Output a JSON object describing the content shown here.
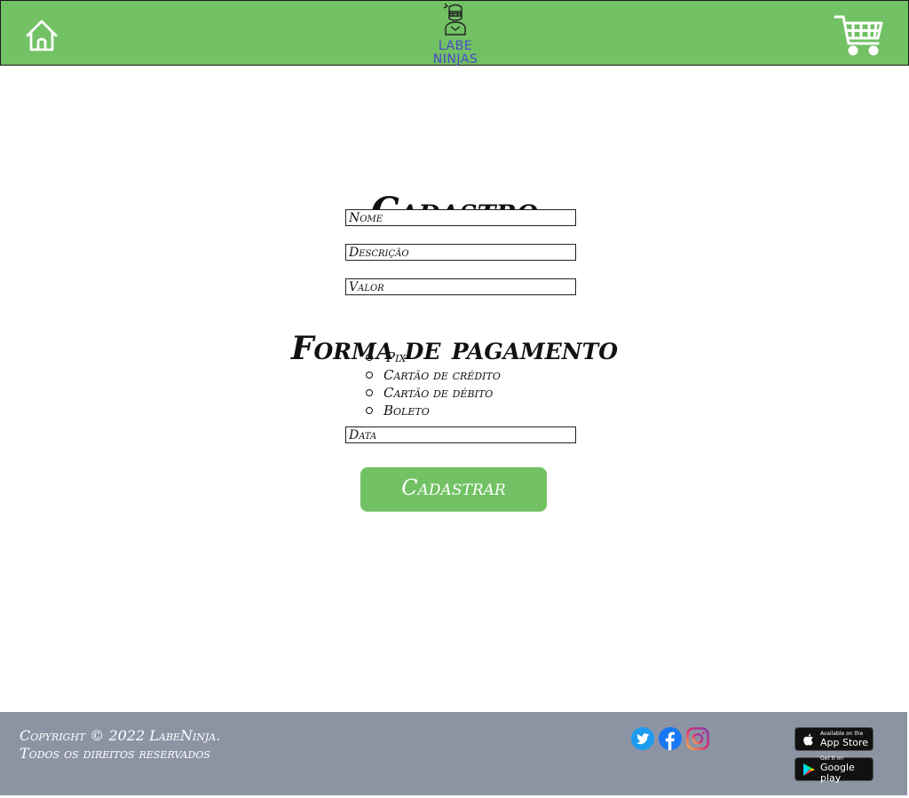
{
  "header": {
    "logo_line1": "LABE",
    "logo_line2": "NINJAS",
    "colors": {
      "bar": "#72c164",
      "logo_text": "#4a48c8"
    }
  },
  "form": {
    "title": "Cadastro",
    "nome_placeholder": "Nome",
    "descricao_placeholder": "Descrição",
    "valor_placeholder": "Valor",
    "payment_title": "Forma de pagamento",
    "payment_options": [
      "Pix",
      "Cartão de crédito",
      "Cartão de débito",
      "Boleto"
    ],
    "data_placeholder": "Data",
    "submit_label": "Cadastrar"
  },
  "footer": {
    "copyright_line1": "Copyright © 2022 LabeNinja.",
    "copyright_line2": "Todos os direitos reservados",
    "apple_small": "Available on the",
    "apple_big": "App Store",
    "google_small": "Get it on",
    "google_big": "Google play",
    "colors": {
      "background": "#8c94a4"
    }
  }
}
